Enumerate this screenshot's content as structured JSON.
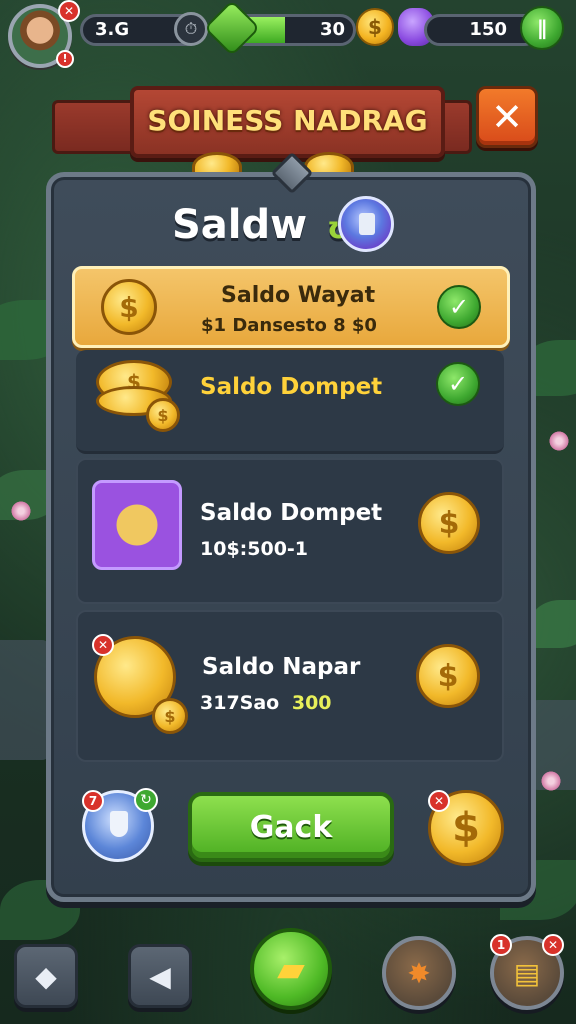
{
  "hud": {
    "level_value": "3.G",
    "coins_value": "30",
    "gems_value": "150",
    "progress_fill": 0.45,
    "avatar_badge": "✕",
    "avatar_small_badge": "!"
  },
  "banner": {
    "title": "SOINESS NADRAG",
    "close_symbol": "✕"
  },
  "panel": {
    "title": "Saldw",
    "title_suffix": "ʊ"
  },
  "rows": [
    {
      "label": "Saldo Wayat",
      "sub": "$1 Dansesto 8 $0",
      "status_icon": "check-icon"
    },
    {
      "label": "Saldo Dompet",
      "status_icon": "check-icon"
    },
    {
      "label": "Saldo Dompet",
      "sub": "10$:500-1",
      "status_icon": "coin-icon"
    },
    {
      "label": "Saldo Napar",
      "sub_main": "317Sao",
      "sub_accent": "300",
      "status_icon": "coin-icon"
    }
  ],
  "buttons": {
    "primary_label": "Gack",
    "coin_symbol": "$"
  },
  "badges": {
    "shield_badge": "7",
    "coin_badge": "✕",
    "dock_badge": "1"
  },
  "colors": {
    "accent_gold": "#f2b92a",
    "accent_green": "#4cae22",
    "banner_red": "#b44734",
    "text_gold": "#ffe07a",
    "sub_yellow": "#e8f05a"
  }
}
